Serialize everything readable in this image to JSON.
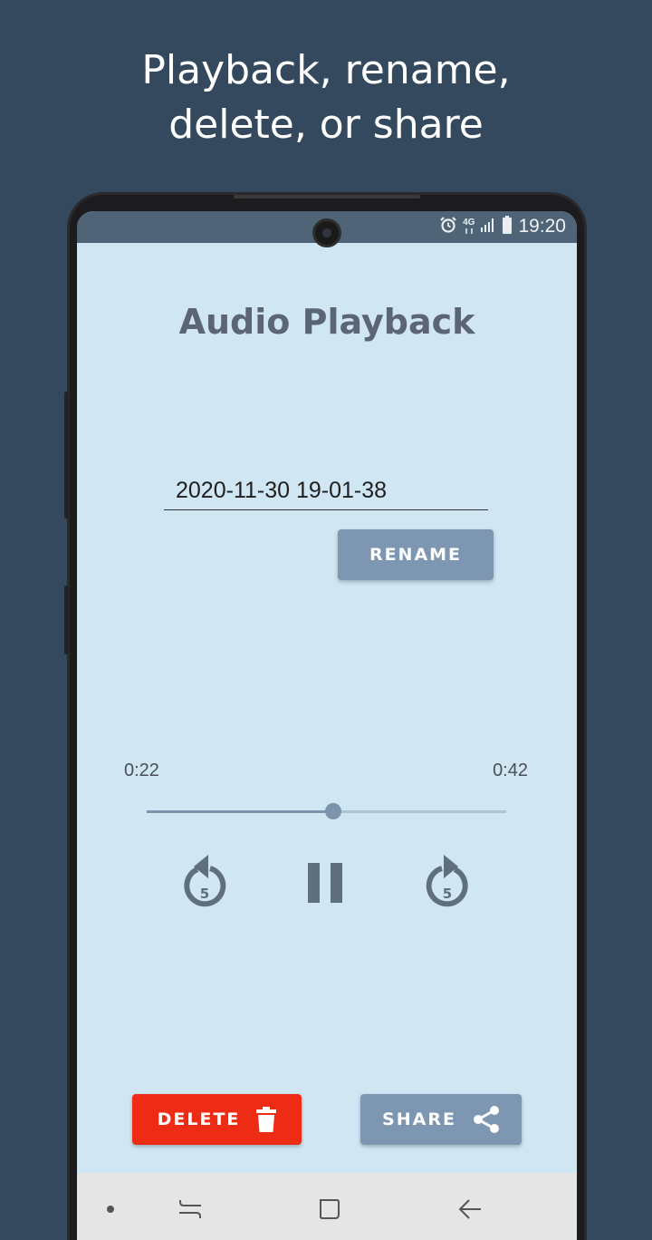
{
  "promo": {
    "line1": "Playback, rename,",
    "line2": "delete, or share"
  },
  "status_bar": {
    "time": "19:20",
    "network": "4G",
    "icons": [
      "alarm-icon",
      "signal-icon",
      "battery-icon"
    ]
  },
  "app": {
    "title": "Audio Playback",
    "recording_name": "2020-11-30 19-01-38",
    "rename_label": "RENAME",
    "current_time": "0:22",
    "total_time": "0:42",
    "progress": 0.52,
    "rewind_seconds": "5",
    "forward_seconds": "5",
    "delete_label": "DELETE",
    "share_label": "SHARE"
  },
  "nav_bar": {
    "items": [
      "dot-icon",
      "recents-icon",
      "home-icon",
      "back-icon"
    ]
  },
  "colors": {
    "background": "#34495e",
    "screen": "#d0e6f3",
    "accent": "#7d97b3",
    "delete": "#ee2b14",
    "icon": "#5f6f7c"
  }
}
